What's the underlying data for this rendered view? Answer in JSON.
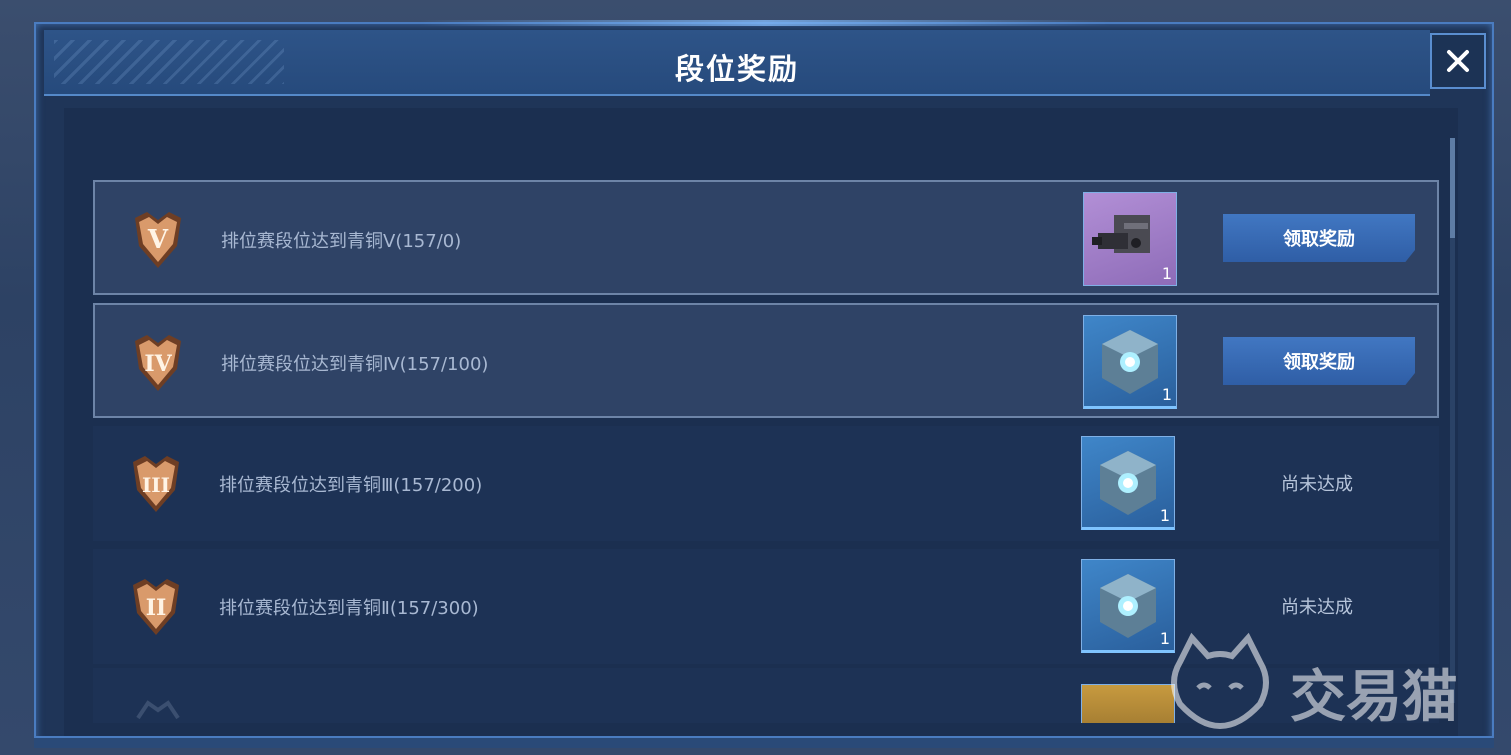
{
  "dialog": {
    "title": "段位奖励",
    "close_icon": "close-icon"
  },
  "rewards": [
    {
      "tier": "V",
      "text": "排位赛段位达到青铜Ⅴ(157/0)",
      "item": "weapon-part",
      "quantity": "1",
      "action": "领取奖励",
      "state": "claimable"
    },
    {
      "tier": "IV",
      "text": "排位赛段位达到青铜Ⅳ(157/100)",
      "item": "crystal-cube",
      "quantity": "1",
      "action": "领取奖励",
      "state": "claimable"
    },
    {
      "tier": "III",
      "text": "排位赛段位达到青铜Ⅲ(157/200)",
      "item": "crystal-cube",
      "quantity": "1",
      "status": "尚未达成",
      "state": "locked"
    },
    {
      "tier": "II",
      "text": "排位赛段位达到青铜Ⅱ(157/300)",
      "item": "crystal-cube",
      "quantity": "1",
      "status": "尚未达成",
      "state": "locked"
    }
  ],
  "watermark": {
    "text": "交易猫"
  },
  "colors": {
    "accent": "#3f74bf",
    "frame": "#4a7cc0",
    "badge": "#d99a6b"
  }
}
